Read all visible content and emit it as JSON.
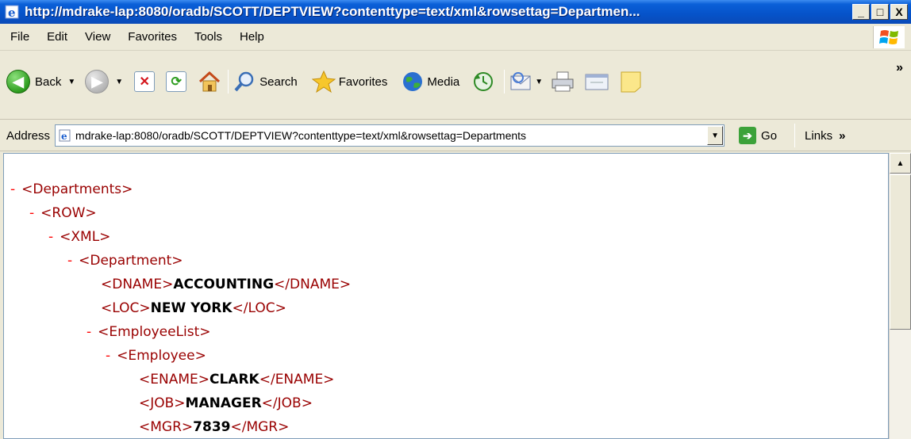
{
  "window": {
    "title": "http://mdrake-lap:8080/oradb/SCOTT/DEPTVIEW?contenttype=text/xml&rowsettag=Departmen...",
    "minimize": "_",
    "maximize": "□",
    "close": "X"
  },
  "menu": {
    "items": [
      "File",
      "Edit",
      "View",
      "Favorites",
      "Tools",
      "Help"
    ]
  },
  "toolbar": {
    "back": "Back",
    "search": "Search",
    "favorites": "Favorites",
    "media": "Media",
    "more": "»"
  },
  "address": {
    "label": "Address",
    "url": "mdrake-lap:8080/oradb/SCOTT/DEPTVIEW?contenttype=text/xml&rowsettag=Departments",
    "go": "Go",
    "links": "Links",
    "links_more": "»"
  },
  "xml": {
    "lines": [
      {
        "minus": "-",
        "open": "<Departments>",
        "value": "",
        "close": ""
      },
      {
        "minus": "-",
        "open": "<ROW>",
        "value": "",
        "close": ""
      },
      {
        "minus": "-",
        "open": "<XML>",
        "value": "",
        "close": ""
      },
      {
        "minus": "-",
        "open": "<Department>",
        "value": "",
        "close": ""
      },
      {
        "minus": "",
        "open": "<DNAME>",
        "value": "ACCOUNTING",
        "close": "</DNAME>"
      },
      {
        "minus": "",
        "open": "<LOC>",
        "value": "NEW YORK",
        "close": "</LOC>"
      },
      {
        "minus": "-",
        "open": "<EmployeeList>",
        "value": "",
        "close": ""
      },
      {
        "minus": "-",
        "open": "<Employee>",
        "value": "",
        "close": ""
      },
      {
        "minus": "",
        "open": "<ENAME>",
        "value": "CLARK",
        "close": "</ENAME>"
      },
      {
        "minus": "",
        "open": "<JOB>",
        "value": "MANAGER",
        "close": "</JOB>"
      },
      {
        "minus": "",
        "open": "<MGR>",
        "value": "7839",
        "close": "</MGR>"
      }
    ]
  },
  "colors": {
    "tag": "#990000",
    "minus": "#ff0000",
    "titlebar": "#0653c9"
  }
}
